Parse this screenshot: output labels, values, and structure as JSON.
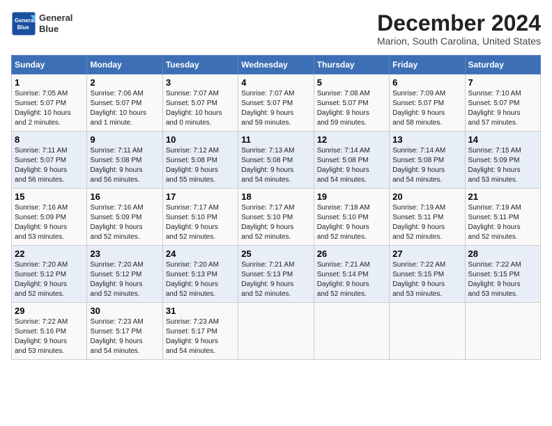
{
  "header": {
    "logo_line1": "General",
    "logo_line2": "Blue",
    "title": "December 2024",
    "subtitle": "Marion, South Carolina, United States"
  },
  "calendar": {
    "weekdays": [
      "Sunday",
      "Monday",
      "Tuesday",
      "Wednesday",
      "Thursday",
      "Friday",
      "Saturday"
    ],
    "weeks": [
      [
        {
          "day": "1",
          "info": "Sunrise: 7:05 AM\nSunset: 5:07 PM\nDaylight: 10 hours\nand 2 minutes."
        },
        {
          "day": "2",
          "info": "Sunrise: 7:06 AM\nSunset: 5:07 PM\nDaylight: 10 hours\nand 1 minute."
        },
        {
          "day": "3",
          "info": "Sunrise: 7:07 AM\nSunset: 5:07 PM\nDaylight: 10 hours\nand 0 minutes."
        },
        {
          "day": "4",
          "info": "Sunrise: 7:07 AM\nSunset: 5:07 PM\nDaylight: 9 hours\nand 59 minutes."
        },
        {
          "day": "5",
          "info": "Sunrise: 7:08 AM\nSunset: 5:07 PM\nDaylight: 9 hours\nand 59 minutes."
        },
        {
          "day": "6",
          "info": "Sunrise: 7:09 AM\nSunset: 5:07 PM\nDaylight: 9 hours\nand 58 minutes."
        },
        {
          "day": "7",
          "info": "Sunrise: 7:10 AM\nSunset: 5:07 PM\nDaylight: 9 hours\nand 57 minutes."
        }
      ],
      [
        {
          "day": "8",
          "info": "Sunrise: 7:11 AM\nSunset: 5:07 PM\nDaylight: 9 hours\nand 56 minutes."
        },
        {
          "day": "9",
          "info": "Sunrise: 7:11 AM\nSunset: 5:08 PM\nDaylight: 9 hours\nand 56 minutes."
        },
        {
          "day": "10",
          "info": "Sunrise: 7:12 AM\nSunset: 5:08 PM\nDaylight: 9 hours\nand 55 minutes."
        },
        {
          "day": "11",
          "info": "Sunrise: 7:13 AM\nSunset: 5:08 PM\nDaylight: 9 hours\nand 54 minutes."
        },
        {
          "day": "12",
          "info": "Sunrise: 7:14 AM\nSunset: 5:08 PM\nDaylight: 9 hours\nand 54 minutes."
        },
        {
          "day": "13",
          "info": "Sunrise: 7:14 AM\nSunset: 5:08 PM\nDaylight: 9 hours\nand 54 minutes."
        },
        {
          "day": "14",
          "info": "Sunrise: 7:15 AM\nSunset: 5:09 PM\nDaylight: 9 hours\nand 53 minutes."
        }
      ],
      [
        {
          "day": "15",
          "info": "Sunrise: 7:16 AM\nSunset: 5:09 PM\nDaylight: 9 hours\nand 53 minutes."
        },
        {
          "day": "16",
          "info": "Sunrise: 7:16 AM\nSunset: 5:09 PM\nDaylight: 9 hours\nand 52 minutes."
        },
        {
          "day": "17",
          "info": "Sunrise: 7:17 AM\nSunset: 5:10 PM\nDaylight: 9 hours\nand 52 minutes."
        },
        {
          "day": "18",
          "info": "Sunrise: 7:17 AM\nSunset: 5:10 PM\nDaylight: 9 hours\nand 52 minutes."
        },
        {
          "day": "19",
          "info": "Sunrise: 7:18 AM\nSunset: 5:10 PM\nDaylight: 9 hours\nand 52 minutes."
        },
        {
          "day": "20",
          "info": "Sunrise: 7:19 AM\nSunset: 5:11 PM\nDaylight: 9 hours\nand 52 minutes."
        },
        {
          "day": "21",
          "info": "Sunrise: 7:19 AM\nSunset: 5:11 PM\nDaylight: 9 hours\nand 52 minutes."
        }
      ],
      [
        {
          "day": "22",
          "info": "Sunrise: 7:20 AM\nSunset: 5:12 PM\nDaylight: 9 hours\nand 52 minutes."
        },
        {
          "day": "23",
          "info": "Sunrise: 7:20 AM\nSunset: 5:12 PM\nDaylight: 9 hours\nand 52 minutes."
        },
        {
          "day": "24",
          "info": "Sunrise: 7:20 AM\nSunset: 5:13 PM\nDaylight: 9 hours\nand 52 minutes."
        },
        {
          "day": "25",
          "info": "Sunrise: 7:21 AM\nSunset: 5:13 PM\nDaylight: 9 hours\nand 52 minutes."
        },
        {
          "day": "26",
          "info": "Sunrise: 7:21 AM\nSunset: 5:14 PM\nDaylight: 9 hours\nand 52 minutes."
        },
        {
          "day": "27",
          "info": "Sunrise: 7:22 AM\nSunset: 5:15 PM\nDaylight: 9 hours\nand 53 minutes."
        },
        {
          "day": "28",
          "info": "Sunrise: 7:22 AM\nSunset: 5:15 PM\nDaylight: 9 hours\nand 53 minutes."
        }
      ],
      [
        {
          "day": "29",
          "info": "Sunrise: 7:22 AM\nSunset: 5:16 PM\nDaylight: 9 hours\nand 53 minutes."
        },
        {
          "day": "30",
          "info": "Sunrise: 7:23 AM\nSunset: 5:17 PM\nDaylight: 9 hours\nand 54 minutes."
        },
        {
          "day": "31",
          "info": "Sunrise: 7:23 AM\nSunset: 5:17 PM\nDaylight: 9 hours\nand 54 minutes."
        },
        null,
        null,
        null,
        null
      ]
    ]
  }
}
